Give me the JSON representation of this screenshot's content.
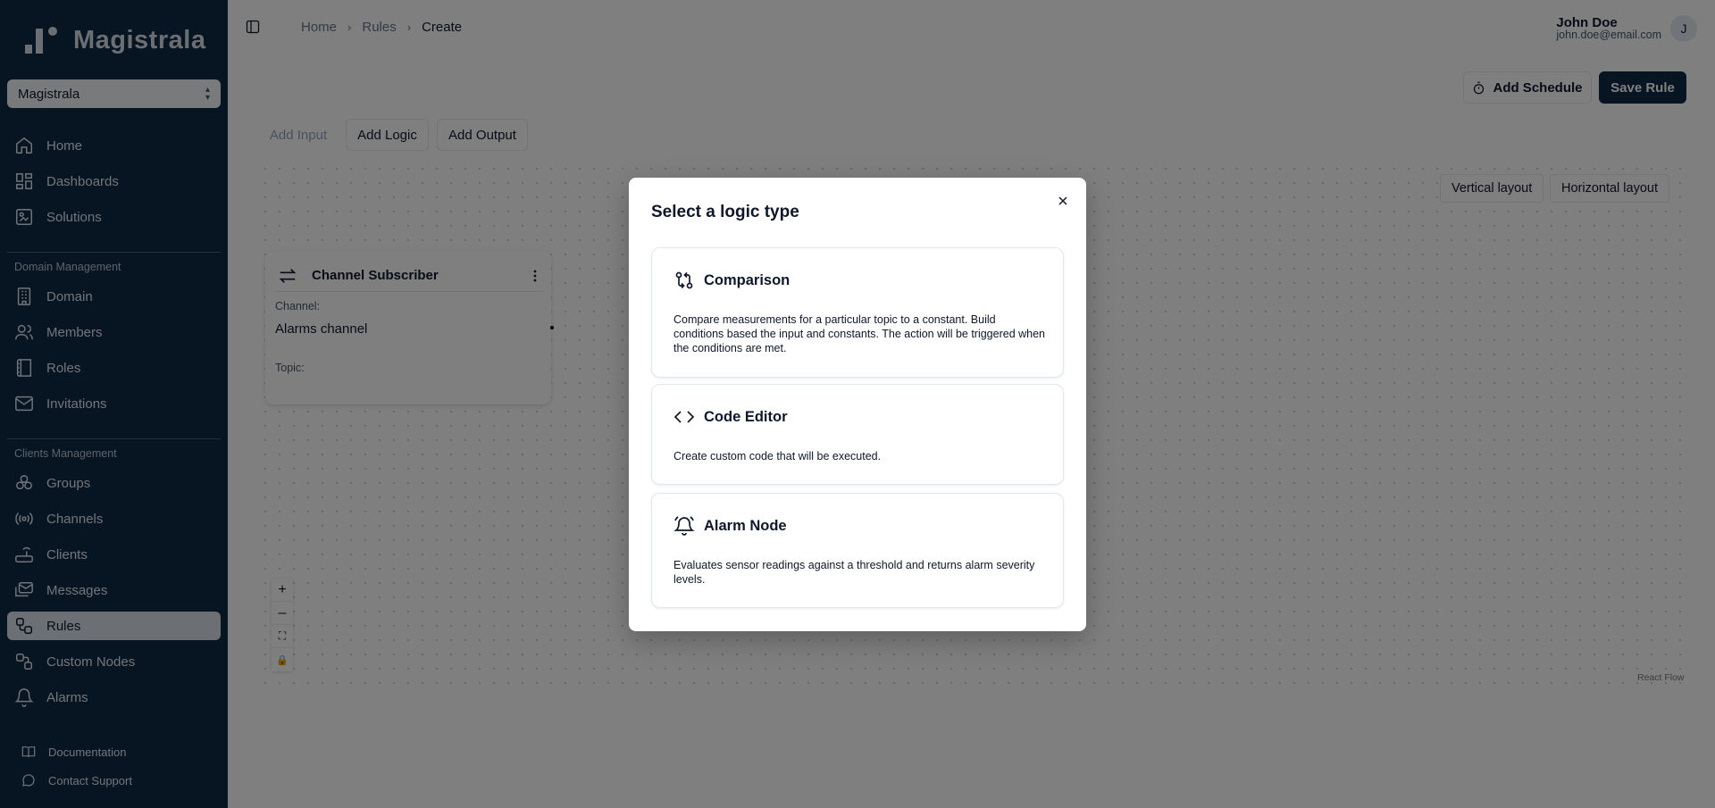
{
  "sidebar": {
    "logo_text": "Magistrala",
    "domain_select": "Magistrala",
    "nav_top": [
      {
        "label": "Home",
        "icon": "home-icon"
      },
      {
        "label": "Dashboards",
        "icon": "dashboard-icon"
      },
      {
        "label": "Solutions",
        "icon": "solutions-icon"
      }
    ],
    "section_domain": "Domain Management",
    "nav_domain": [
      {
        "label": "Domain",
        "icon": "building-icon"
      },
      {
        "label": "Members",
        "icon": "users-icon"
      },
      {
        "label": "Roles",
        "icon": "book-icon"
      },
      {
        "label": "Invitations",
        "icon": "mail-icon"
      }
    ],
    "section_clients": "Clients Management",
    "nav_clients": [
      {
        "label": "Groups",
        "icon": "groups-icon"
      },
      {
        "label": "Channels",
        "icon": "radio-icon"
      },
      {
        "label": "Clients",
        "icon": "router-icon"
      },
      {
        "label": "Messages",
        "icon": "messages-icon"
      },
      {
        "label": "Rules",
        "icon": "workflow-icon",
        "active": true
      },
      {
        "label": "Custom Nodes",
        "icon": "nodes-icon"
      },
      {
        "label": "Alarms",
        "icon": "bell-icon"
      }
    ],
    "footer": [
      {
        "label": "Documentation",
        "icon": "book-open-icon"
      },
      {
        "label": "Contact Support",
        "icon": "chat-icon"
      }
    ]
  },
  "header": {
    "breadcrumbs": [
      "Home",
      "Rules",
      "Create"
    ],
    "user_name": "John Doe",
    "user_email": "john.doe@email.com",
    "avatar_initial": "J"
  },
  "toolbar": {
    "add_schedule": "Add Schedule",
    "save_rule": "Save Rule",
    "add_input": "Add Input",
    "add_logic": "Add Logic",
    "add_output": "Add Output"
  },
  "canvas": {
    "vertical_layout": "Vertical layout",
    "horizontal_layout": "Horizontal layout",
    "attribution": "React Flow",
    "controls": [
      "+",
      "–",
      "⛶",
      "🔒"
    ],
    "node": {
      "title": "Channel Subscriber",
      "channel_label": "Channel:",
      "channel_value": "Alarms channel",
      "topic_label": "Topic:"
    }
  },
  "modal": {
    "title": "Select a logic type",
    "options": [
      {
        "title": "Comparison",
        "icon": "git-compare-icon",
        "description": "Compare measurements for a particular topic to a constant. Build conditions based the input and constants. The action will be triggered when the conditions are met."
      },
      {
        "title": "Code Editor",
        "icon": "code-icon",
        "description": "Create custom code that will be executed."
      },
      {
        "title": "Alarm Node",
        "icon": "alarm-bell-icon",
        "description": "Evaluates sensor readings against a threshold and returns alarm severity levels."
      }
    ]
  },
  "colors": {
    "sidebar_bg": "#0f2a44",
    "primary": "#0f2a44",
    "active_nav_bg": "#d8dee6"
  }
}
